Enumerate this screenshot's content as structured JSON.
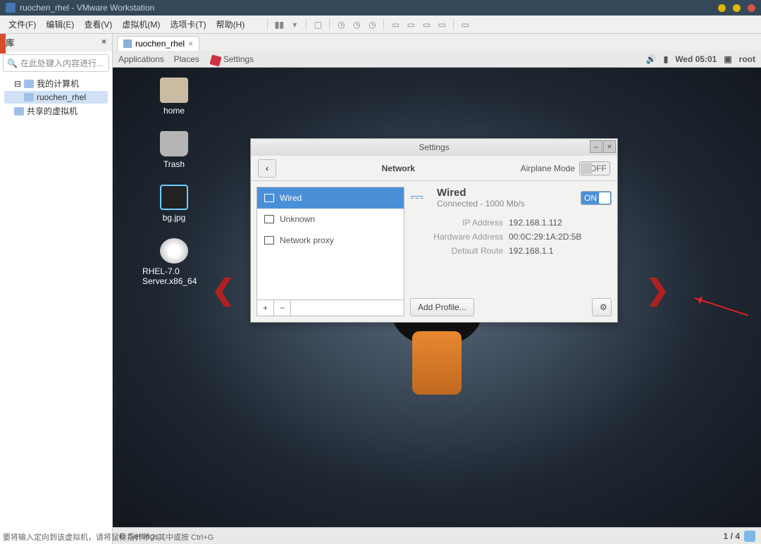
{
  "titlebar": {
    "title": "ruochen_rhel - VMware Workstation"
  },
  "menubar": {
    "items": [
      "文件(F)",
      "编辑(E)",
      "查看(V)",
      "虚拟机(M)",
      "选项卡(T)",
      "帮助(H)"
    ]
  },
  "sidebar": {
    "header": "库",
    "close": "×",
    "search_placeholder": "在此处键入内容进行...",
    "tree": [
      {
        "label": "我的计算机",
        "indent": 0
      },
      {
        "label": "ruochen_rhel",
        "indent": 1,
        "selected": true
      },
      {
        "label": "共享的虚拟机",
        "indent": 0
      }
    ]
  },
  "tab": {
    "label": "ruochen_rhel",
    "close": "×"
  },
  "gnome_top": {
    "apps": "Applications",
    "places": "Places",
    "settings": "Settings",
    "time": "Wed 05:01",
    "user": "root"
  },
  "desktop": {
    "icons": [
      {
        "label": "home",
        "cls": "home"
      },
      {
        "label": "Trash",
        "cls": "trash"
      },
      {
        "label": "bg.jpg",
        "cls": "bg"
      },
      {
        "label": "RHEL-7.0 Server.x86_64",
        "cls": "cd"
      }
    ]
  },
  "settings_window": {
    "title": "Settings",
    "section": "Network",
    "airplane_label": "Airplane Mode",
    "airplane_off": "OFF",
    "list": [
      {
        "label": "Wired",
        "selected": true
      },
      {
        "label": "Unknown"
      },
      {
        "label": "Network proxy"
      }
    ],
    "list_add": "+",
    "list_remove": "−",
    "detail": {
      "name": "Wired",
      "status": "Connected - 1000 Mb/s",
      "on": "ON",
      "props": [
        {
          "k": "IP Address",
          "v": "192.168.1.112"
        },
        {
          "k": "Hardware Address",
          "v": "00:0C:29:1A:2D:5B"
        },
        {
          "k": "Default Route",
          "v": "192.168.1.1"
        }
      ],
      "add_profile": "Add Profile...",
      "gear": "⚙"
    }
  },
  "gnome_bottom": {
    "task": "Settings",
    "counter": "1 / 4"
  },
  "footer_hint": "要将输入定向到该虚拟机，请将鼠标指针移入其中或按 Ctrl+G"
}
